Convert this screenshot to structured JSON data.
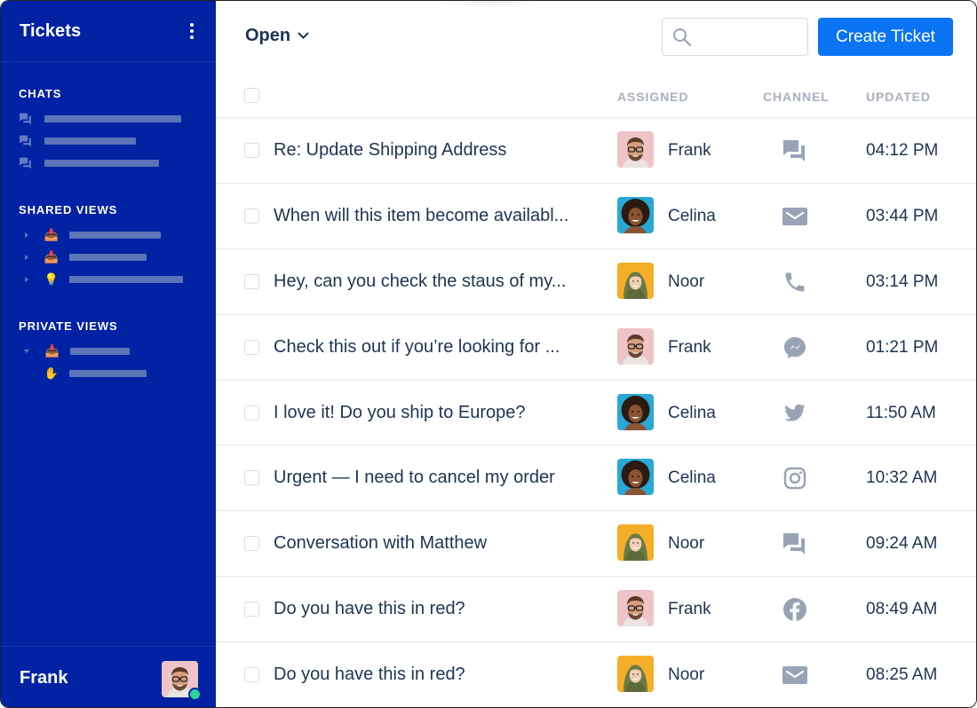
{
  "sidebar": {
    "title": "Tickets",
    "menu_icon": "kebab-menu-icon",
    "sections": [
      {
        "title": "CHATS",
        "items": [
          {
            "icon": "chat-bubbles-icon",
            "label_placeholder": "redacted"
          },
          {
            "icon": "chat-bubbles-icon",
            "label_placeholder": "redacted"
          },
          {
            "icon": "chat-bubbles-icon",
            "label_placeholder": "redacted"
          }
        ]
      },
      {
        "title": "SHARED VIEWS",
        "items": [
          {
            "expander": "collapsed",
            "icon": "inbox-tray-emoji",
            "emoji": "📥"
          },
          {
            "expander": "collapsed",
            "icon": "inbox-tray-emoji",
            "emoji": "📥"
          },
          {
            "expander": "collapsed",
            "icon": "light-bulb-emoji",
            "emoji": "💡"
          }
        ]
      },
      {
        "title": "PRIVATE VIEWS",
        "items": [
          {
            "expander": "expanded",
            "icon": "inbox-tray-emoji",
            "emoji": "📥"
          },
          {
            "expander": "none",
            "icon": "raised-hand-emoji",
            "emoji": "✋"
          }
        ]
      }
    ],
    "footer": {
      "user_name": "Frank",
      "status": "online",
      "status_color": "#2ed39a"
    }
  },
  "toolbar": {
    "view_filter": "Open",
    "search": {
      "value": "",
      "placeholder": ""
    },
    "create_label": "Create Ticket",
    "accent_color": "#0b74f5"
  },
  "table": {
    "columns": [
      "ASSIGNED",
      "CHANNEL",
      "UPDATED"
    ],
    "rows": [
      {
        "subject": "Re: Update Shipping Address",
        "assignee": "Frank",
        "channel": "chat",
        "updated": "04:12 PM"
      },
      {
        "subject": "When will this item become availabl...",
        "assignee": "Celina",
        "channel": "email",
        "updated": "03:44 PM"
      },
      {
        "subject": "Hey, can you check the staus of my...",
        "assignee": "Noor",
        "channel": "phone",
        "updated": "03:14 PM"
      },
      {
        "subject": "Check this out if you’re looking for ...",
        "assignee": "Frank",
        "channel": "messenger",
        "updated": "01:21 PM"
      },
      {
        "subject": "I love it! Do you ship to Europe?",
        "assignee": "Celina",
        "channel": "twitter",
        "updated": "11:50 AM"
      },
      {
        "subject": "Urgent — I need to cancel my order",
        "assignee": "Celina",
        "channel": "instagram",
        "updated": "10:32 AM"
      },
      {
        "subject": "Conversation with Matthew",
        "assignee": "Noor",
        "channel": "chat",
        "updated": "09:24 AM"
      },
      {
        "subject": "Do you have this in red?",
        "assignee": "Frank",
        "channel": "facebook",
        "updated": "08:49 AM"
      },
      {
        "subject": "Do you have this in red?",
        "assignee": "Noor",
        "channel": "email",
        "updated": "08:25 AM"
      }
    ]
  },
  "colors": {
    "sidebar_bg": "#0022a3",
    "text_primary": "#1e3354",
    "icon_gray": "#98a4b6",
    "header_gray": "#a8b0bd"
  }
}
